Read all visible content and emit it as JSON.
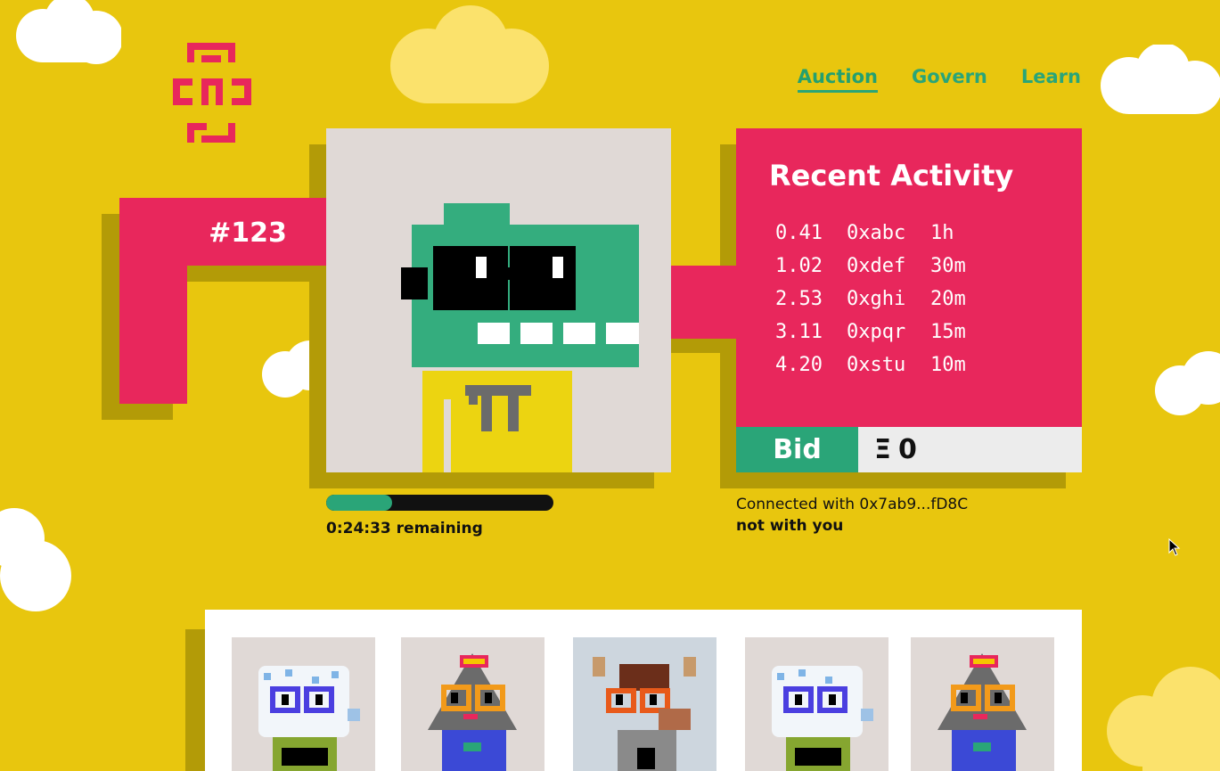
{
  "nav": {
    "items": [
      {
        "label": "Auction",
        "active": true
      },
      {
        "label": "Govern",
        "active": false
      },
      {
        "label": "Learn",
        "active": false
      }
    ]
  },
  "auction": {
    "lot_number": "#123",
    "progress_fraction": 0.29,
    "remaining": "0:24:33 remaining"
  },
  "activity": {
    "title": "Recent Activity",
    "rows": [
      {
        "amount": "0.41",
        "address": "0xabc",
        "time": "1h"
      },
      {
        "amount": "1.02",
        "address": "0xdef",
        "time": "30m"
      },
      {
        "amount": "2.53",
        "address": "0xghi",
        "time": "20m"
      },
      {
        "amount": "3.11",
        "address": "0xpqr",
        "time": "15m"
      },
      {
        "amount": "4.20",
        "address": "0xstu",
        "time": "10m"
      }
    ]
  },
  "bid": {
    "button_label": "Bid",
    "currency_symbol": "Ξ",
    "value": "0"
  },
  "wallet": {
    "connected_text": "Connected with 0x7ab9...fD8C",
    "status_text": "not with you"
  },
  "colors": {
    "background": "#e8c60e",
    "pink": "#e8275c",
    "green": "#2aa578",
    "shadow": "#b39b07"
  },
  "icons": [
    "logo-icon",
    "cloud-icon",
    "mouse-cursor-icon"
  ]
}
